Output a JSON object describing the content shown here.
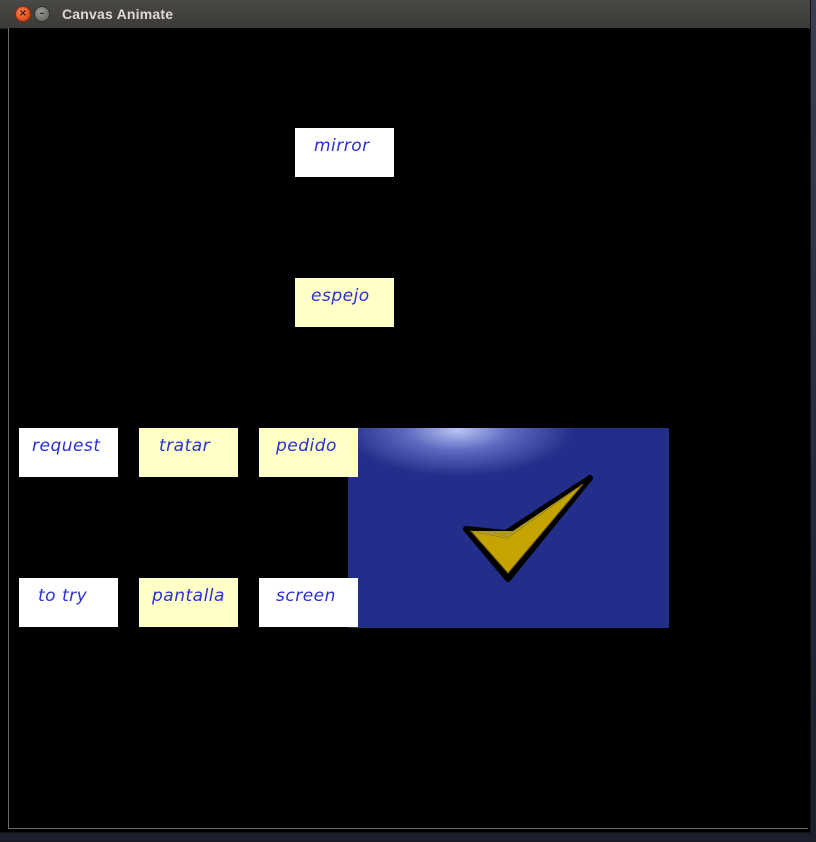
{
  "window": {
    "title": "Canvas Animate",
    "close_glyph": "×",
    "minimize_glyph": "–"
  },
  "cards": {
    "mirror": "mirror",
    "espejo": "espejo",
    "request": "request",
    "tratar": "tratar",
    "pedido": "pedido",
    "to_try": "to try",
    "pantalla": "pantalla",
    "screen": "screen"
  },
  "colors": {
    "canvas_bg": "#000000",
    "card_white": "#ffffff",
    "card_yellow": "#ffffc8",
    "card_text": "#2a2fd9",
    "panel_blue": "#232e8a",
    "check_gold": "#c8a800"
  },
  "icons": {
    "checkmark": "checkmark-icon"
  }
}
